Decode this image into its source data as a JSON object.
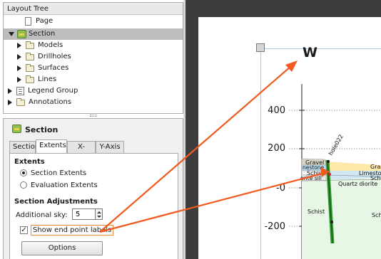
{
  "tree": {
    "header": "Layout Tree",
    "items": [
      {
        "label": "Page"
      },
      {
        "label": "Section"
      },
      {
        "label": "Models"
      },
      {
        "label": "Drillholes"
      },
      {
        "label": "Surfaces"
      },
      {
        "label": "Lines"
      },
      {
        "label": "Legend Group"
      },
      {
        "label": "Annotations"
      }
    ]
  },
  "props": {
    "title": "Section",
    "tabs": [
      "Section",
      "Extents",
      "X-Axis",
      "Y-Axis"
    ],
    "active_tab": "Extents",
    "extents_label": "Extents",
    "radio_section_extents": "Section Extents",
    "radio_evaluation_extents": "Evaluation Extents",
    "adjustments_label": "Section Adjustments",
    "sky_label": "Additional sky:",
    "sky_value": "5",
    "show_end_point_labels": "Show end point labels",
    "show_end_point_labels_checked": true,
    "options_button": "Options"
  },
  "canvas": {
    "direction_label": "W",
    "y_ticks": [
      "400",
      "200",
      "-0",
      "-200"
    ],
    "drillhole_label": "hole022",
    "unit_labels": [
      "Gravel",
      "nestone",
      "Schist",
      "orite sill",
      "Gra",
      "Limesto",
      "Sch",
      "Quartz diorite",
      "Schist",
      "Sch"
    ],
    "colors": {
      "gravel": "#d9d6c8",
      "limestone": "#b9dcef",
      "schist_band": "#ffe9a8",
      "quartz_diorite": "#e8f6e6",
      "drillhole": "#2e9b2e",
      "pointer": "#f05a1e"
    }
  }
}
